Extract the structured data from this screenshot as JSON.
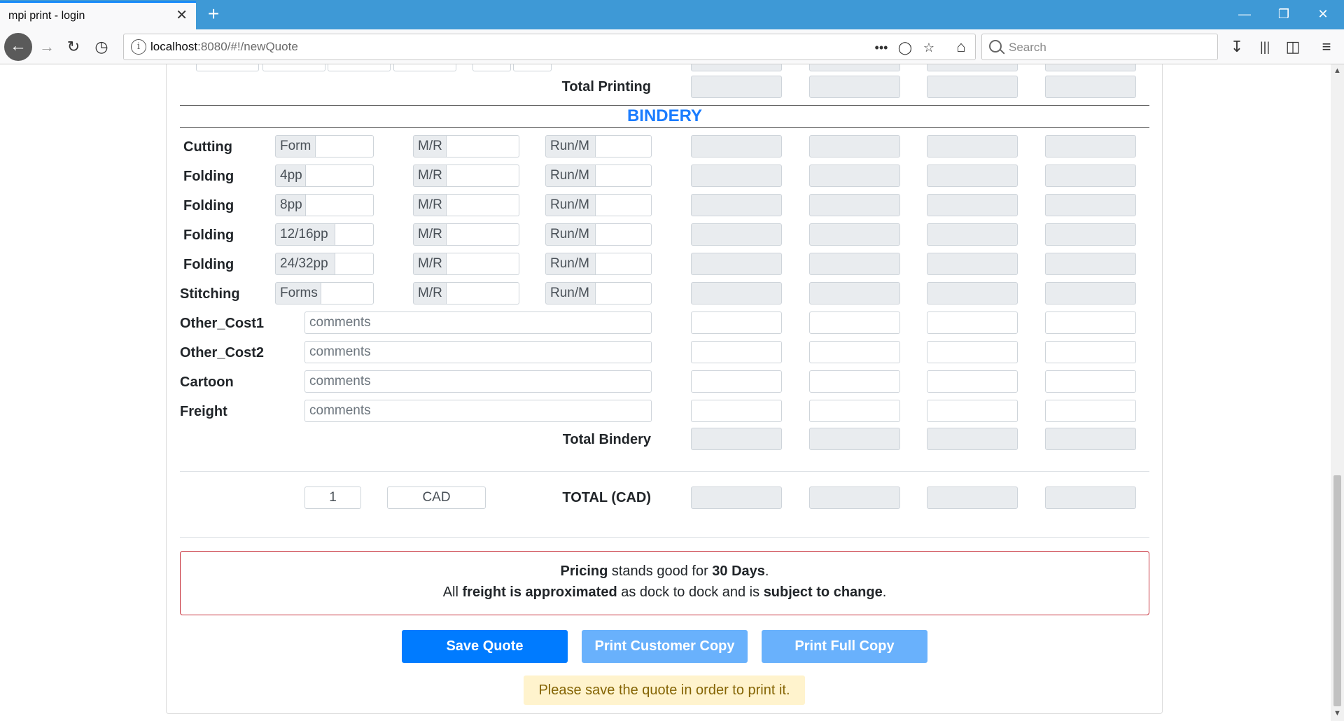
{
  "browser": {
    "tab_title": "mpi print - login",
    "tab_close": "✕",
    "new_tab": "+",
    "url_host": "localhost",
    "url_path": ":8080/#!/newQuote",
    "search_placeholder": "Search"
  },
  "printing": {
    "total_label": "Total Printing"
  },
  "bindery": {
    "title": "BINDERY",
    "rows": [
      {
        "label": "Cutting",
        "prefix": "Form",
        "mr": "M/R",
        "run": "Run/M"
      },
      {
        "label": "Folding",
        "prefix": "4pp",
        "mr": "M/R",
        "run": "Run/M"
      },
      {
        "label": "Folding",
        "prefix": "8pp",
        "mr": "M/R",
        "run": "Run/M"
      },
      {
        "label": "Folding",
        "prefix": "12/16pp",
        "mr": "M/R",
        "run": "Run/M"
      },
      {
        "label": "Folding",
        "prefix": "24/32pp",
        "mr": "M/R",
        "run": "Run/M"
      },
      {
        "label": "Stitching",
        "prefix": "Forms",
        "mr": "M/R",
        "run": "Run/M"
      }
    ],
    "other_rows": [
      {
        "label": "Other_Cost1",
        "placeholder": "comments"
      },
      {
        "label": "Other_Cost2",
        "placeholder": "comments"
      },
      {
        "label": "Cartoon",
        "placeholder": "comments"
      },
      {
        "label": "Freight",
        "placeholder": "comments"
      }
    ],
    "total_label": "Total Bindery"
  },
  "total": {
    "rate_value": "1",
    "currency": "CAD",
    "label": "TOTAL (CAD)"
  },
  "notice": {
    "line1_bold1": "Pricing",
    "line1_text": " stands good for ",
    "line1_bold2": "30 Days",
    "line1_end": ".",
    "line2_text1": "All ",
    "line2_bold1": "freight is approximated",
    "line2_text2": " as dock to dock and is ",
    "line2_bold2": "subject to change",
    "line2_end": "."
  },
  "buttons": {
    "save": "Save Quote",
    "print_customer": "Print Customer Copy",
    "print_full": "Print Full Copy"
  },
  "warning": "Please save the quote in order to print it.",
  "colors": {
    "tab_bar": "#3e99d6",
    "primary": "#007bff",
    "primary_disabled": "#69b1fc",
    "section_title": "#1a7cff",
    "notice_border": "#c8343f",
    "warning_bg": "#fff3cd"
  }
}
